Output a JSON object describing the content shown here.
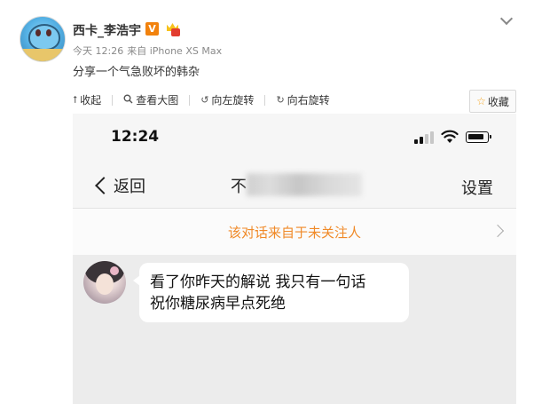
{
  "post": {
    "username": "西卡_李浩宇",
    "verified_badge": "V",
    "time": "今天 12:26",
    "source": "来自 iPhone XS Max",
    "content": "分享一个气急败坏的韩杂",
    "icons": {
      "avatar": "squirtle-avatar",
      "more": "chevron-down-icon",
      "vip": "crown-icon"
    }
  },
  "toolbar": {
    "collapse": "收起",
    "view_large": "查看大图",
    "rotate_left": "向左旋转",
    "rotate_right": "向右旋转",
    "collect": "收藏",
    "icons": {
      "collapse": "arrow-up-icon",
      "view_large": "magnifier-icon",
      "rotate_left": "rotate-left-icon",
      "rotate_right": "rotate-right-icon",
      "collect": "star-icon"
    }
  },
  "screenshot": {
    "status_time": "12:24",
    "back_label": "返回",
    "chat_title_visible": "不",
    "settings_label": "设置",
    "notice": "该对话来自于未关注人",
    "message_lines": [
      "看了你昨天的解说 我只有一句话",
      "祝你糖尿病早点死绝"
    ],
    "colors": {
      "notice": "#f08a28",
      "chat_bg": "#ececec",
      "bubble": "#ffffff"
    }
  }
}
